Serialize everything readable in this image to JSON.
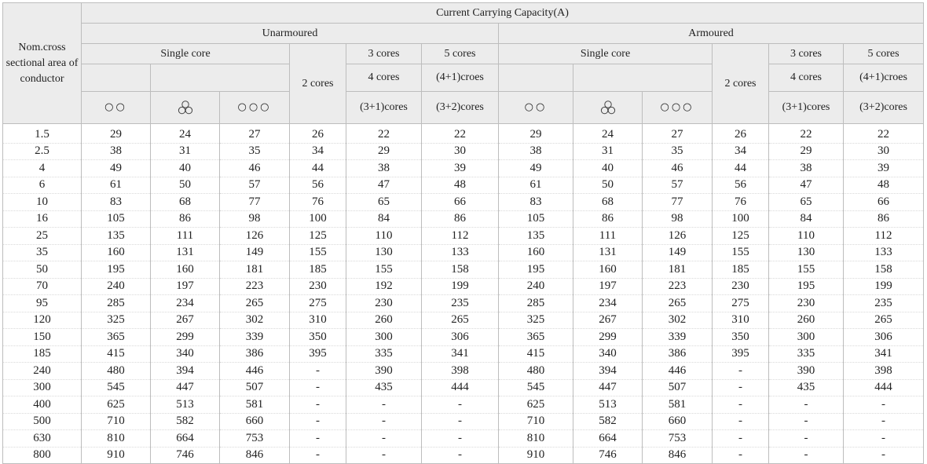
{
  "header": {
    "nom_label": "Nom.cross sectional area of conductor",
    "top": "Current Carrying Capacity(A)",
    "unarmoured": "Unarmoured",
    "armoured": "Armoured",
    "single_core": "Single core",
    "two_cores": "2 cores",
    "three_cores": "3 cores",
    "four_cores": "4 cores",
    "three_one_cores": "(3+1)cores",
    "five_cores": "5 cores",
    "four_one_croes": "(4+1)croes",
    "three_two_cores": "(3+2)cores",
    "sym_flat_two": "○○",
    "sym_trefoil": "trefoil-icon",
    "sym_flat_three": "○○○"
  },
  "rows": [
    [
      "1.5",
      "29",
      "24",
      "27",
      "26",
      "22",
      "22",
      "29",
      "24",
      "27",
      "26",
      "22",
      "22"
    ],
    [
      "2.5",
      "38",
      "31",
      "35",
      "34",
      "29",
      "30",
      "38",
      "31",
      "35",
      "34",
      "29",
      "30"
    ],
    [
      "4",
      "49",
      "40",
      "46",
      "44",
      "38",
      "39",
      "49",
      "40",
      "46",
      "44",
      "38",
      "39"
    ],
    [
      "6",
      "61",
      "50",
      "57",
      "56",
      "47",
      "48",
      "61",
      "50",
      "57",
      "56",
      "47",
      "48"
    ],
    [
      "10",
      "83",
      "68",
      "77",
      "76",
      "65",
      "66",
      "83",
      "68",
      "77",
      "76",
      "65",
      "66"
    ],
    [
      "16",
      "105",
      "86",
      "98",
      "100",
      "84",
      "86",
      "105",
      "86",
      "98",
      "100",
      "84",
      "86"
    ],
    [
      "25",
      "135",
      "111",
      "126",
      "125",
      "110",
      "112",
      "135",
      "111",
      "126",
      "125",
      "110",
      "112"
    ],
    [
      "35",
      "160",
      "131",
      "149",
      "155",
      "130",
      "133",
      "160",
      "131",
      "149",
      "155",
      "130",
      "133"
    ],
    [
      "50",
      "195",
      "160",
      "181",
      "185",
      "155",
      "158",
      "195",
      "160",
      "181",
      "185",
      "155",
      "158"
    ],
    [
      "70",
      "240",
      "197",
      "223",
      "230",
      "192",
      "199",
      "240",
      "197",
      "223",
      "230",
      "195",
      "199"
    ],
    [
      "95",
      "285",
      "234",
      "265",
      "275",
      "230",
      "235",
      "285",
      "234",
      "265",
      "275",
      "230",
      "235"
    ],
    [
      "120",
      "325",
      "267",
      "302",
      "310",
      "260",
      "265",
      "325",
      "267",
      "302",
      "310",
      "260",
      "265"
    ],
    [
      "150",
      "365",
      "299",
      "339",
      "350",
      "300",
      "306",
      "365",
      "299",
      "339",
      "350",
      "300",
      "306"
    ],
    [
      "185",
      "415",
      "340",
      "386",
      "395",
      "335",
      "341",
      "415",
      "340",
      "386",
      "395",
      "335",
      "341"
    ],
    [
      "240",
      "480",
      "394",
      "446",
      "-",
      "390",
      "398",
      "480",
      "394",
      "446",
      "-",
      "390",
      "398"
    ],
    [
      "300",
      "545",
      "447",
      "507",
      "-",
      "435",
      "444",
      "545",
      "447",
      "507",
      "-",
      "435",
      "444"
    ],
    [
      "400",
      "625",
      "513",
      "581",
      "-",
      "-",
      "-",
      "625",
      "513",
      "581",
      "-",
      "-",
      "-"
    ],
    [
      "500",
      "710",
      "582",
      "660",
      "-",
      "-",
      "-",
      "710",
      "582",
      "660",
      "-",
      "-",
      "-"
    ],
    [
      "630",
      "810",
      "664",
      "753",
      "-",
      "-",
      "-",
      "810",
      "664",
      "753",
      "-",
      "-",
      "-"
    ],
    [
      "800",
      "910",
      "746",
      "846",
      "-",
      "-",
      "-",
      "910",
      "746",
      "846",
      "-",
      "-",
      "-"
    ]
  ]
}
